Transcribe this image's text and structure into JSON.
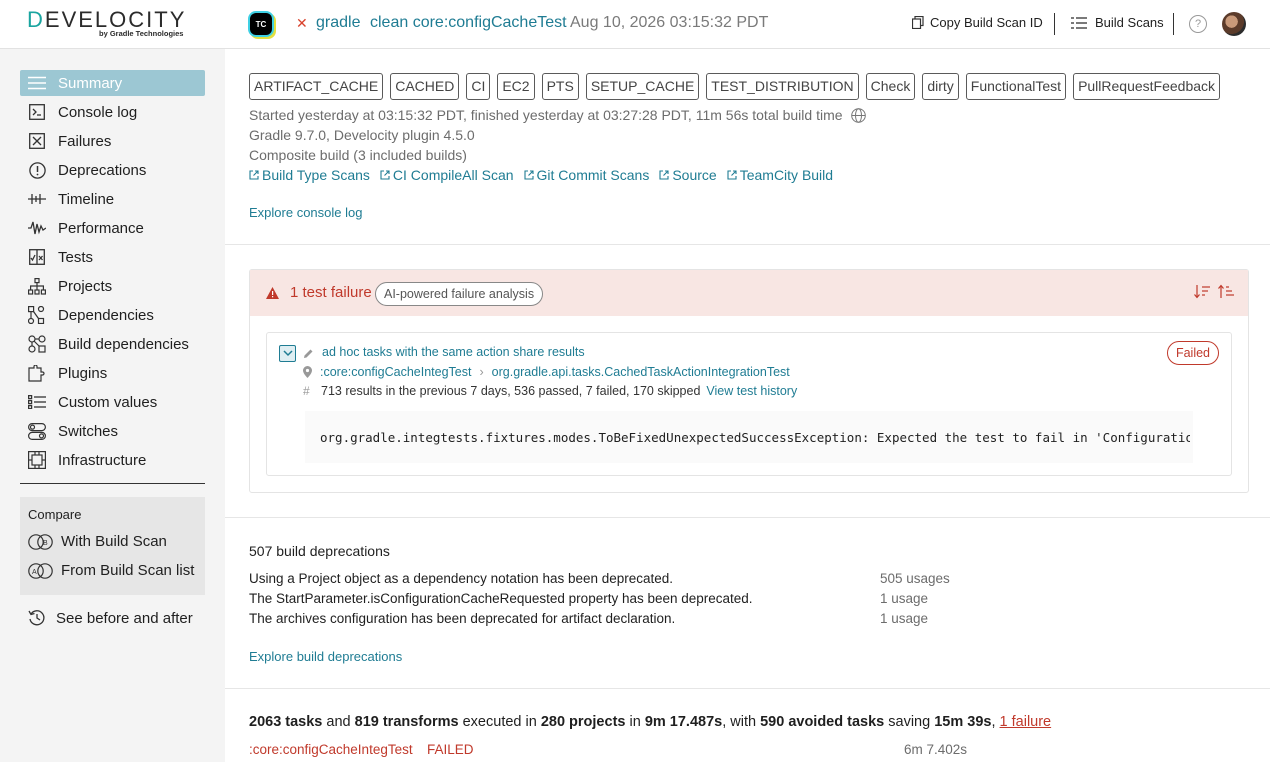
{
  "header": {
    "logo_text": "DEVELOCITY",
    "logo_sub": "by Gradle Technologies",
    "tc_icon": "TC",
    "status_icon": "close-icon",
    "project": "gradle",
    "task": "clean core:configCacheTest",
    "date": "Aug 10, 2026 03:15:32 PDT",
    "copy_label": "Copy Build Scan ID",
    "scans_label": "Build Scans",
    "help": "?"
  },
  "sidebar": {
    "items": [
      {
        "label": "Summary",
        "icon": "summary-icon"
      },
      {
        "label": "Console log",
        "icon": "console-icon"
      },
      {
        "label": "Failures",
        "icon": "failures-icon"
      },
      {
        "label": "Deprecations",
        "icon": "deprecations-icon"
      },
      {
        "label": "Timeline",
        "icon": "timeline-icon"
      },
      {
        "label": "Performance",
        "icon": "performance-icon"
      },
      {
        "label": "Tests",
        "icon": "tests-icon"
      },
      {
        "label": "Projects",
        "icon": "projects-icon"
      },
      {
        "label": "Dependencies",
        "icon": "dependencies-icon"
      },
      {
        "label": "Build dependencies",
        "icon": "build-dependencies-icon"
      },
      {
        "label": "Plugins",
        "icon": "plugins-icon"
      },
      {
        "label": "Custom values",
        "icon": "custom-values-icon"
      },
      {
        "label": "Switches",
        "icon": "switches-icon"
      },
      {
        "label": "Infrastructure",
        "icon": "infrastructure-icon"
      }
    ],
    "compare_title": "Compare",
    "compare_with": "With Build Scan",
    "compare_from": "From Build Scan list",
    "see_before": "See before and after"
  },
  "summary": {
    "tags": [
      "ARTIFACT_CACHE",
      "CACHED",
      "CI",
      "EC2",
      "PTS",
      "SETUP_CACHE",
      "TEST_DISTRIBUTION",
      "Check",
      "dirty",
      "FunctionalTest",
      "PullRequestFeedback"
    ],
    "started": "Started yesterday at 03:15:32 PDT, finished yesterday at 03:27:28 PDT, 11m 56s total build time",
    "versions": "Gradle 9.7.0, Develocity plugin 4.5.0",
    "composite": "Composite build (3 included builds)",
    "links": [
      "Build Type Scans",
      "CI CompileAll Scan",
      "Git Commit Scans",
      "Source",
      "TeamCity Build"
    ],
    "explore_console": "Explore console log"
  },
  "failures": {
    "title": "1 test failure",
    "ai_chip": "AI-powered failure analysis",
    "test_name": "ad hoc tasks with the same action share results",
    "test_project": ":core:configCacheIntegTest",
    "test_class": "org.gradle.api.tasks.CachedTaskActionIntegrationTest",
    "stats": "713 results in the previous 7 days, 536 passed, 7 failed, 170 skipped",
    "history_link": "View test history",
    "status": "Failed",
    "exception": "org.gradle.integtests.fixtures.modes.ToBeFixedUnexpectedSuccessException: Expected the test to fail in 'Configuration Cache'"
  },
  "deprecations": {
    "title": "507 build deprecations",
    "rows": [
      {
        "text": "Using a Project object as a dependency notation has been deprecated.",
        "usage": "505 usages"
      },
      {
        "text": "The StartParameter.isConfigurationCacheRequested property has been deprecated.",
        "usage": "1 usage"
      },
      {
        "text": "The archives configuration has been deprecated for artifact declaration.",
        "usage": "1 usage"
      }
    ],
    "explore": "Explore build deprecations"
  },
  "tasks": {
    "tasks_count": "2063 tasks",
    "and": " and ",
    "transforms": "819 transforms",
    "executed_in": " executed in ",
    "projects": "280 projects",
    "in": " in ",
    "duration": "9m 17.487s",
    "with": ", with ",
    "avoided": "590 avoided tasks",
    "saving": " saving ",
    "saved": "15m 39s",
    "comma": ", ",
    "failure_link": "1 failure",
    "row_name": ":core:configCacheIntegTest",
    "row_status": "FAILED",
    "row_time": "6m 7.402s"
  }
}
